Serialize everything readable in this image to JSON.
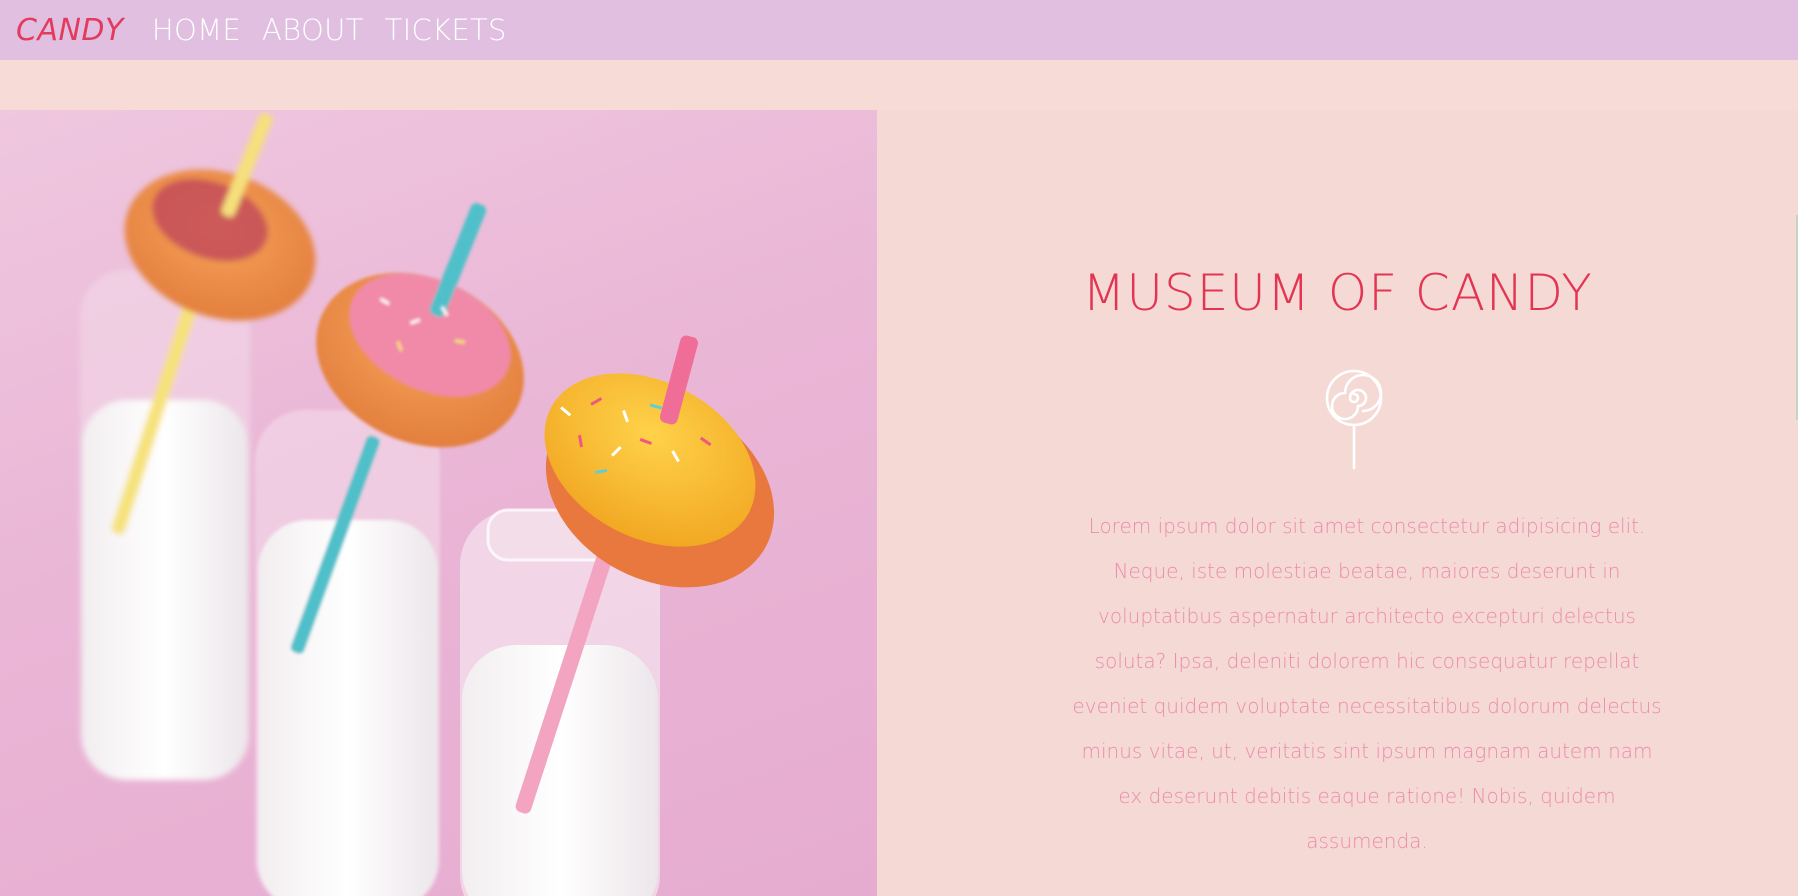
{
  "nav": {
    "brand": "CANDY",
    "links": [
      "HOME",
      "ABOUT",
      "TICKETS"
    ]
  },
  "hero": {
    "image_alt": "donuts on milk bottles with striped straws"
  },
  "info": {
    "title": "MUSEUM OF CANDY",
    "icon": "lollipop-icon",
    "body": "Lorem ipsum dolor sit amet consectetur adipisicing elit. Neque, iste molestiae beatae, maiores deserunt in voluptatibus aspernatur architecto excepturi delectus soluta? Ipsa, deleniti dolorem hic consequatur repellat eveniet quidem voluptate necessitatibus dolorum delectus minus vitae, ut, veritatis sint ipsum magnam autem nam ex deserunt debitis eaque ratione! Nobis, quidem assumenda."
  },
  "colors": {
    "nav_bg": "#e0bfe0",
    "brand": "#e33b5e",
    "page_bg": "#f5d9d5",
    "title": "#e33552",
    "body_text": "#ec8cab"
  }
}
